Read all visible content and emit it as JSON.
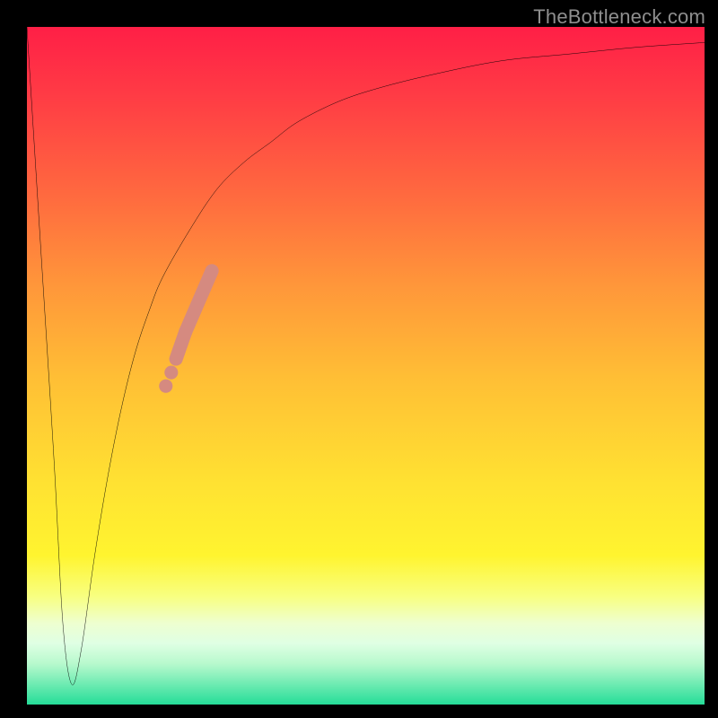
{
  "attribution": "TheBottleneck.com",
  "colors": {
    "curve": "#000000",
    "marker": "#d58a80",
    "plot_border": "#000000"
  },
  "chart_data": {
    "type": "line",
    "title": "",
    "xlabel": "",
    "ylabel": "",
    "xlim": [
      0,
      100
    ],
    "ylim": [
      0,
      100
    ],
    "series": [
      {
        "name": "bottleneck-curve",
        "x": [
          0,
          2,
          4,
          5.3,
          6.6,
          8,
          10,
          12,
          14,
          16,
          18,
          20,
          24,
          28,
          32,
          36,
          40,
          46,
          52,
          60,
          70,
          80,
          90,
          100
        ],
        "y": [
          100,
          68,
          36,
          12,
          3,
          8,
          22,
          34,
          44,
          52,
          58,
          63,
          70,
          76,
          80,
          83,
          86,
          89,
          91,
          93,
          95,
          96,
          97,
          97.7
        ]
      }
    ],
    "markers": [
      {
        "name": "dot-1",
        "x": 20.5,
        "y": 47,
        "r": 1.0
      },
      {
        "name": "dot-2",
        "x": 21.3,
        "y": 49,
        "r": 1.0
      },
      {
        "name": "seg-1",
        "x0": 22.0,
        "y0": 51,
        "x1": 23.4,
        "y1": 55,
        "w": 2.0
      },
      {
        "name": "seg-2",
        "x0": 23.4,
        "y0": 55,
        "x1": 27.3,
        "y1": 64,
        "w": 2.0
      }
    ]
  }
}
